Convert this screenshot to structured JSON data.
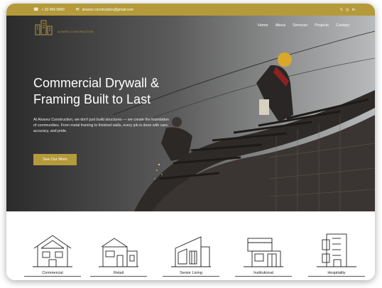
{
  "topbar": {
    "phone": "+ 33 456 5840",
    "email": "alvarez.construction@gmail.com",
    "social": [
      {
        "icon": "x-icon",
        "glyph": "𝕏"
      },
      {
        "icon": "instagram-icon",
        "glyph": "◎"
      },
      {
        "icon": "linkedin-icon",
        "glyph": "in"
      }
    ]
  },
  "logo": {
    "text": "ALVAREZ CONSTRUCTION"
  },
  "nav": [
    "Home",
    "About",
    "Services",
    "Projects",
    "Contact"
  ],
  "hero": {
    "headline_line1": "Commercial Drywall &",
    "headline_line2": "Framing Built to Last",
    "description": "At Alvarez Construction, we don't just build structures — we create the foundation of communities. From metal framing to finished walls, every job is done with care, accuracy, and pride.",
    "cta_label": "See Our Work"
  },
  "categories": [
    {
      "label": "Commercial",
      "icon": "commercial-building-icon"
    },
    {
      "label": "Retail",
      "icon": "retail-building-icon"
    },
    {
      "label": "Senior Living",
      "icon": "senior-living-building-icon"
    },
    {
      "label": "Institutional",
      "icon": "institutional-building-icon"
    },
    {
      "label": "Hospitality",
      "icon": "hospitality-building-icon"
    }
  ],
  "colors": {
    "accent": "#b49a3a",
    "hero_dark": "#2f2f2f",
    "text_light": "#ffffff"
  }
}
